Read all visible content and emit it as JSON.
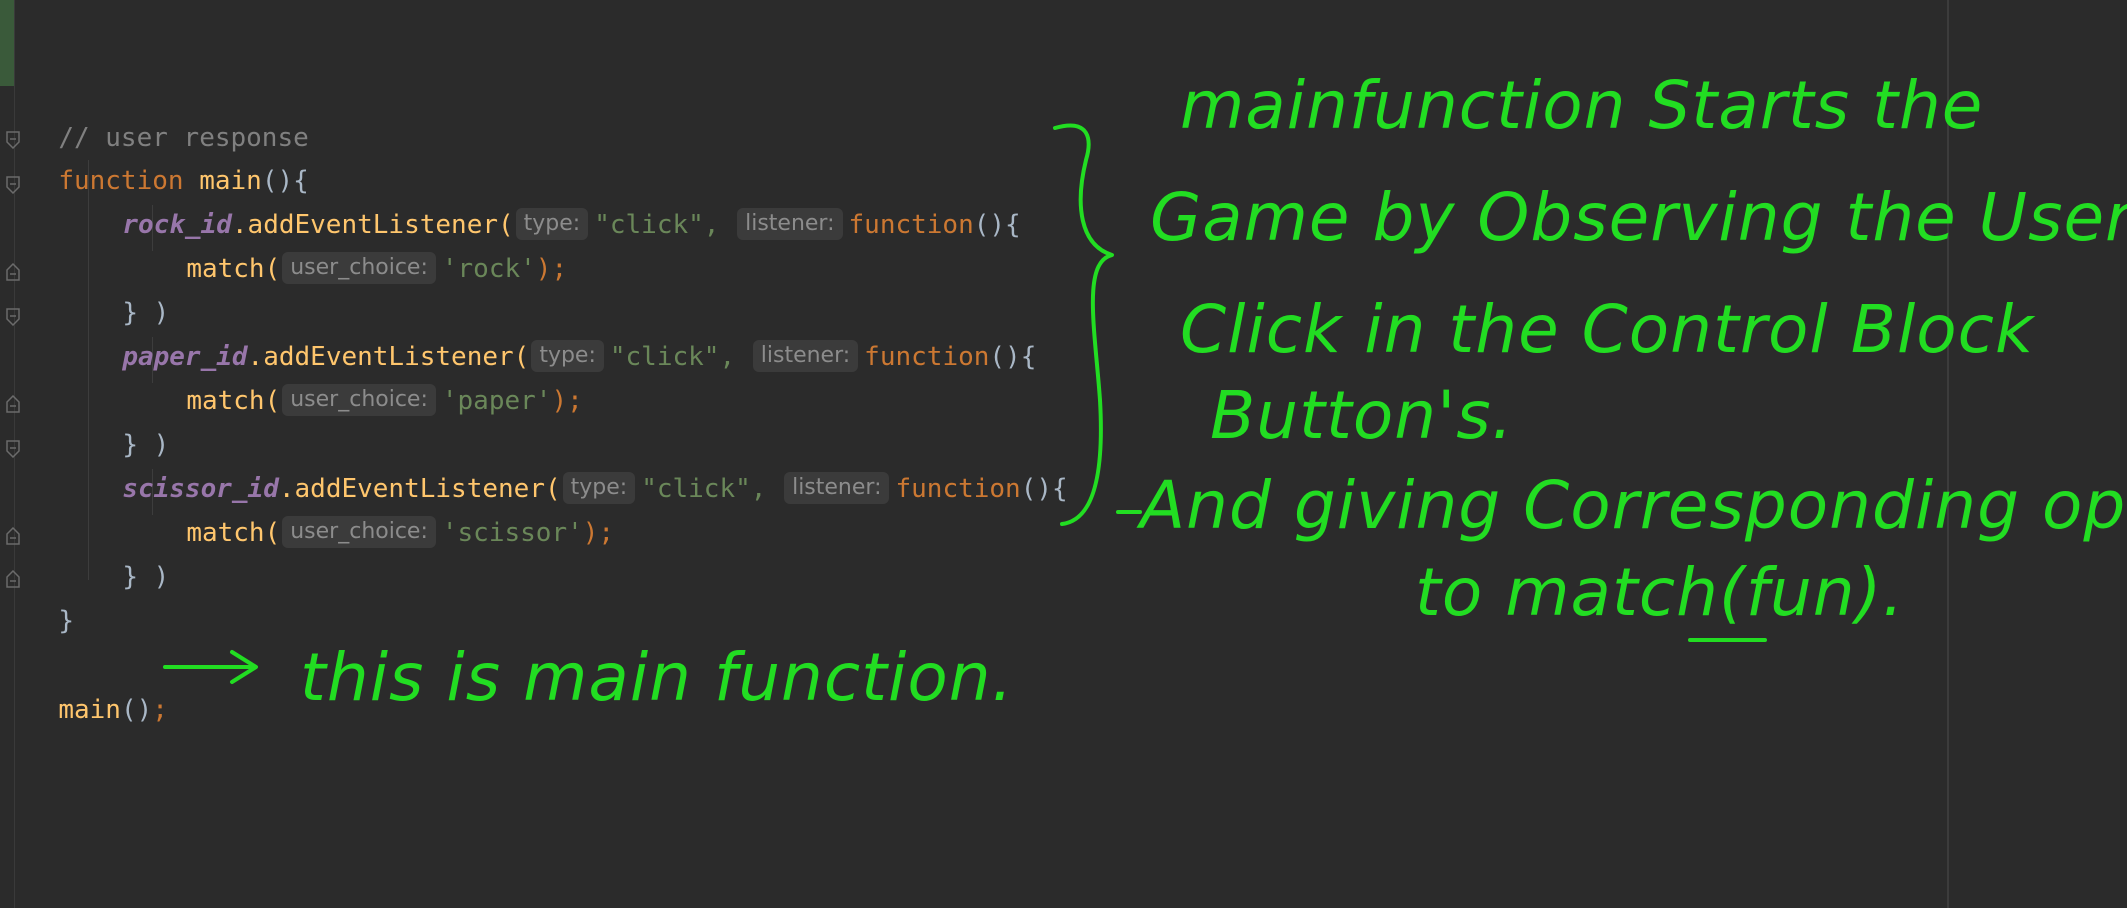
{
  "editor": {
    "comment": "// user response",
    "kw_function": "function",
    "main_name": "main",
    "open_brace": "(){",
    "close_main": "}",
    "listeners": [
      {
        "id": "rock_id",
        "method": ".addEventListener(",
        "hint_type": "type:",
        "event": "\"click\",",
        "hint_listener": "listener:",
        "fn_kw": "function",
        "fn_open": "(){",
        "call": "match(",
        "hint_choice": "user_choice:",
        "arg": "'rock'",
        "call_close": ");",
        "close": "} )"
      },
      {
        "id": "paper_id",
        "method": ".addEventListener(",
        "hint_type": "type:",
        "event": "\"click\",",
        "hint_listener": "listener:",
        "fn_kw": "function",
        "fn_open": "(){",
        "call": "match(",
        "hint_choice": "user_choice:",
        "arg": "'paper'",
        "call_close": ");",
        "close": "} )"
      },
      {
        "id": "scissor_id",
        "method": ".addEventListener(",
        "hint_type": "type:",
        "event": "\"click\",",
        "hint_listener": "listener:",
        "fn_kw": "function",
        "fn_open": "(){",
        "call": "match(",
        "hint_choice": "user_choice:",
        "arg": "'scissor'",
        "call_close": ");",
        "close": "} )"
      }
    ],
    "main_call": "main",
    "main_call_paren": "()",
    "main_call_semi": ";"
  },
  "annotations": {
    "note_main_call": "this is main function.",
    "note_block_lines": [
      "mainfunction Starts the",
      "Game by Observing the User's",
      "Click in the Control Block",
      "Button's.",
      "And giving Corresponding options",
      "to match(fun)."
    ]
  },
  "colors": {
    "background": "#2b2b2b",
    "ink": "#22dd22",
    "keyword": "#cc7832",
    "function_name": "#ffc66d",
    "field": "#9876aa",
    "string": "#6a8759",
    "comment": "#808080"
  }
}
